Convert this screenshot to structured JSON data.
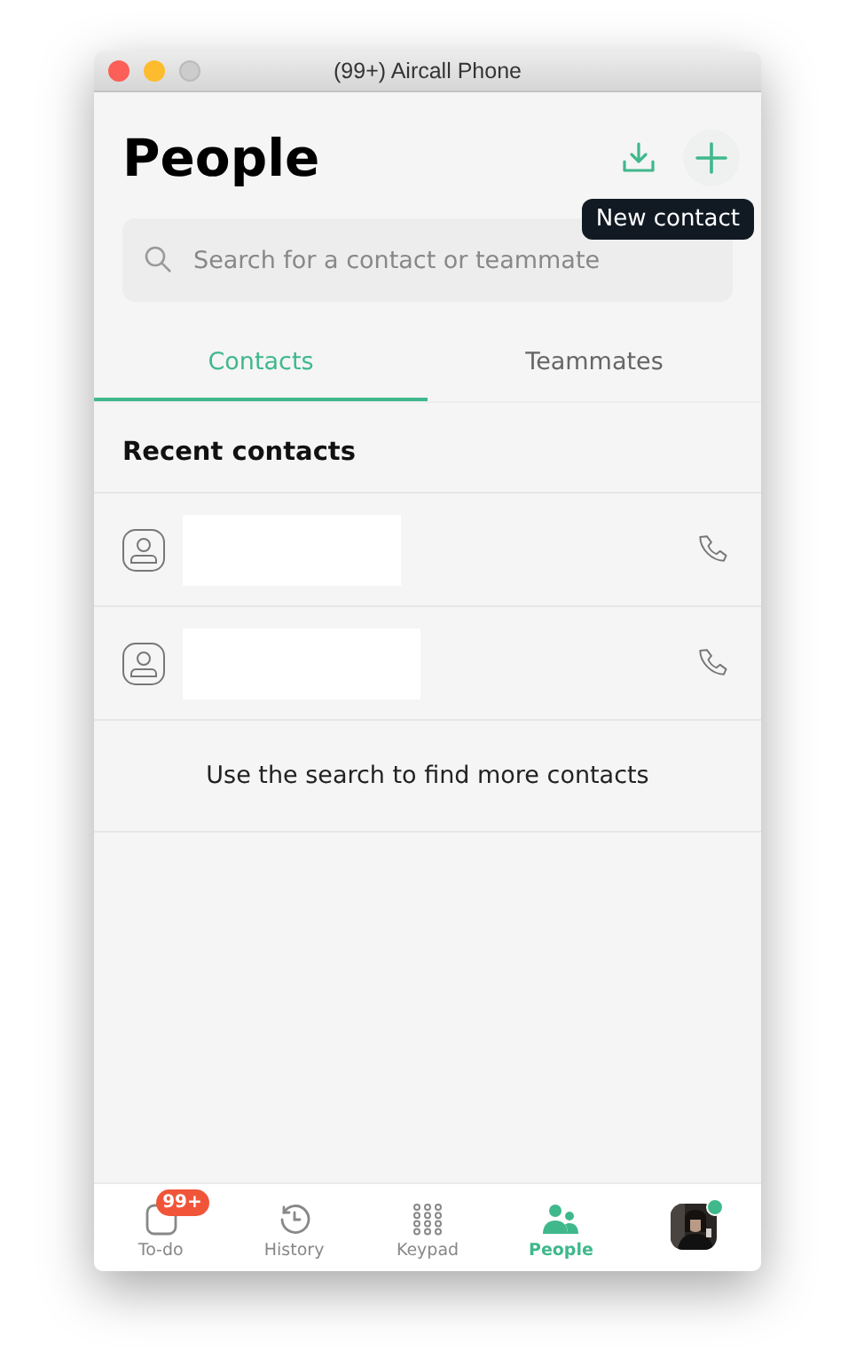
{
  "window": {
    "title": "(99+) Aircall Phone"
  },
  "header": {
    "title": "People",
    "tooltip": "New contact"
  },
  "search": {
    "placeholder": "Search for a contact or teammate"
  },
  "tabs": [
    {
      "label": "Contacts",
      "selected": true
    },
    {
      "label": "Teammates",
      "selected": false
    }
  ],
  "section_title": "Recent contacts",
  "contacts": [
    {
      "name_redacted": true
    },
    {
      "name_redacted": true
    }
  ],
  "hint": "Use the search to find more contacts",
  "nav": [
    {
      "kind": "todo",
      "label": "To-do",
      "badge": "99+",
      "selected": false
    },
    {
      "kind": "history",
      "label": "History",
      "selected": false
    },
    {
      "kind": "keypad",
      "label": "Keypad",
      "selected": false
    },
    {
      "kind": "people",
      "label": "People",
      "selected": true
    },
    {
      "kind": "avatar",
      "online": true,
      "selected": false
    }
  ]
}
